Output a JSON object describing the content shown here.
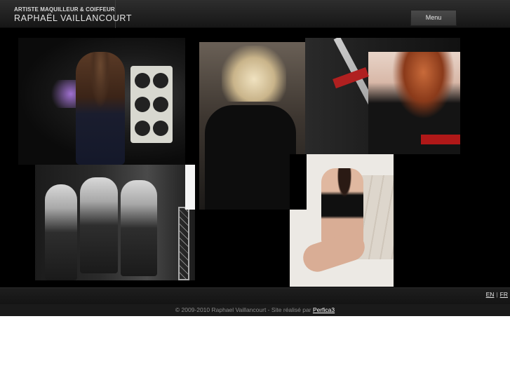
{
  "header": {
    "logo_line1": "ARTISTE MAQUILLEUR & COIFFEUR",
    "logo_line2": "RAPHAËL VAILLANCOURT",
    "menu_label": "Menu"
  },
  "gallery": {
    "photos": [
      "photo-singer-purple-dress",
      "photo-blonde-singer-mic",
      "photo-redhead-performer-mic",
      "photo-dancers-bw",
      "photo-model-lingerie"
    ]
  },
  "languages": {
    "en": "EN",
    "separator": "|",
    "fr": "FR"
  },
  "footer": {
    "copyright": "© 2009-2010 Raphael Vaillancourt - Site réalisé par",
    "credit_link": "Perfica3"
  },
  "colors": {
    "background": "#000000",
    "header": "#222222",
    "menu_button": "#3d3d3d",
    "link": "#ffffff",
    "footer_text": "#8a8a8a"
  }
}
